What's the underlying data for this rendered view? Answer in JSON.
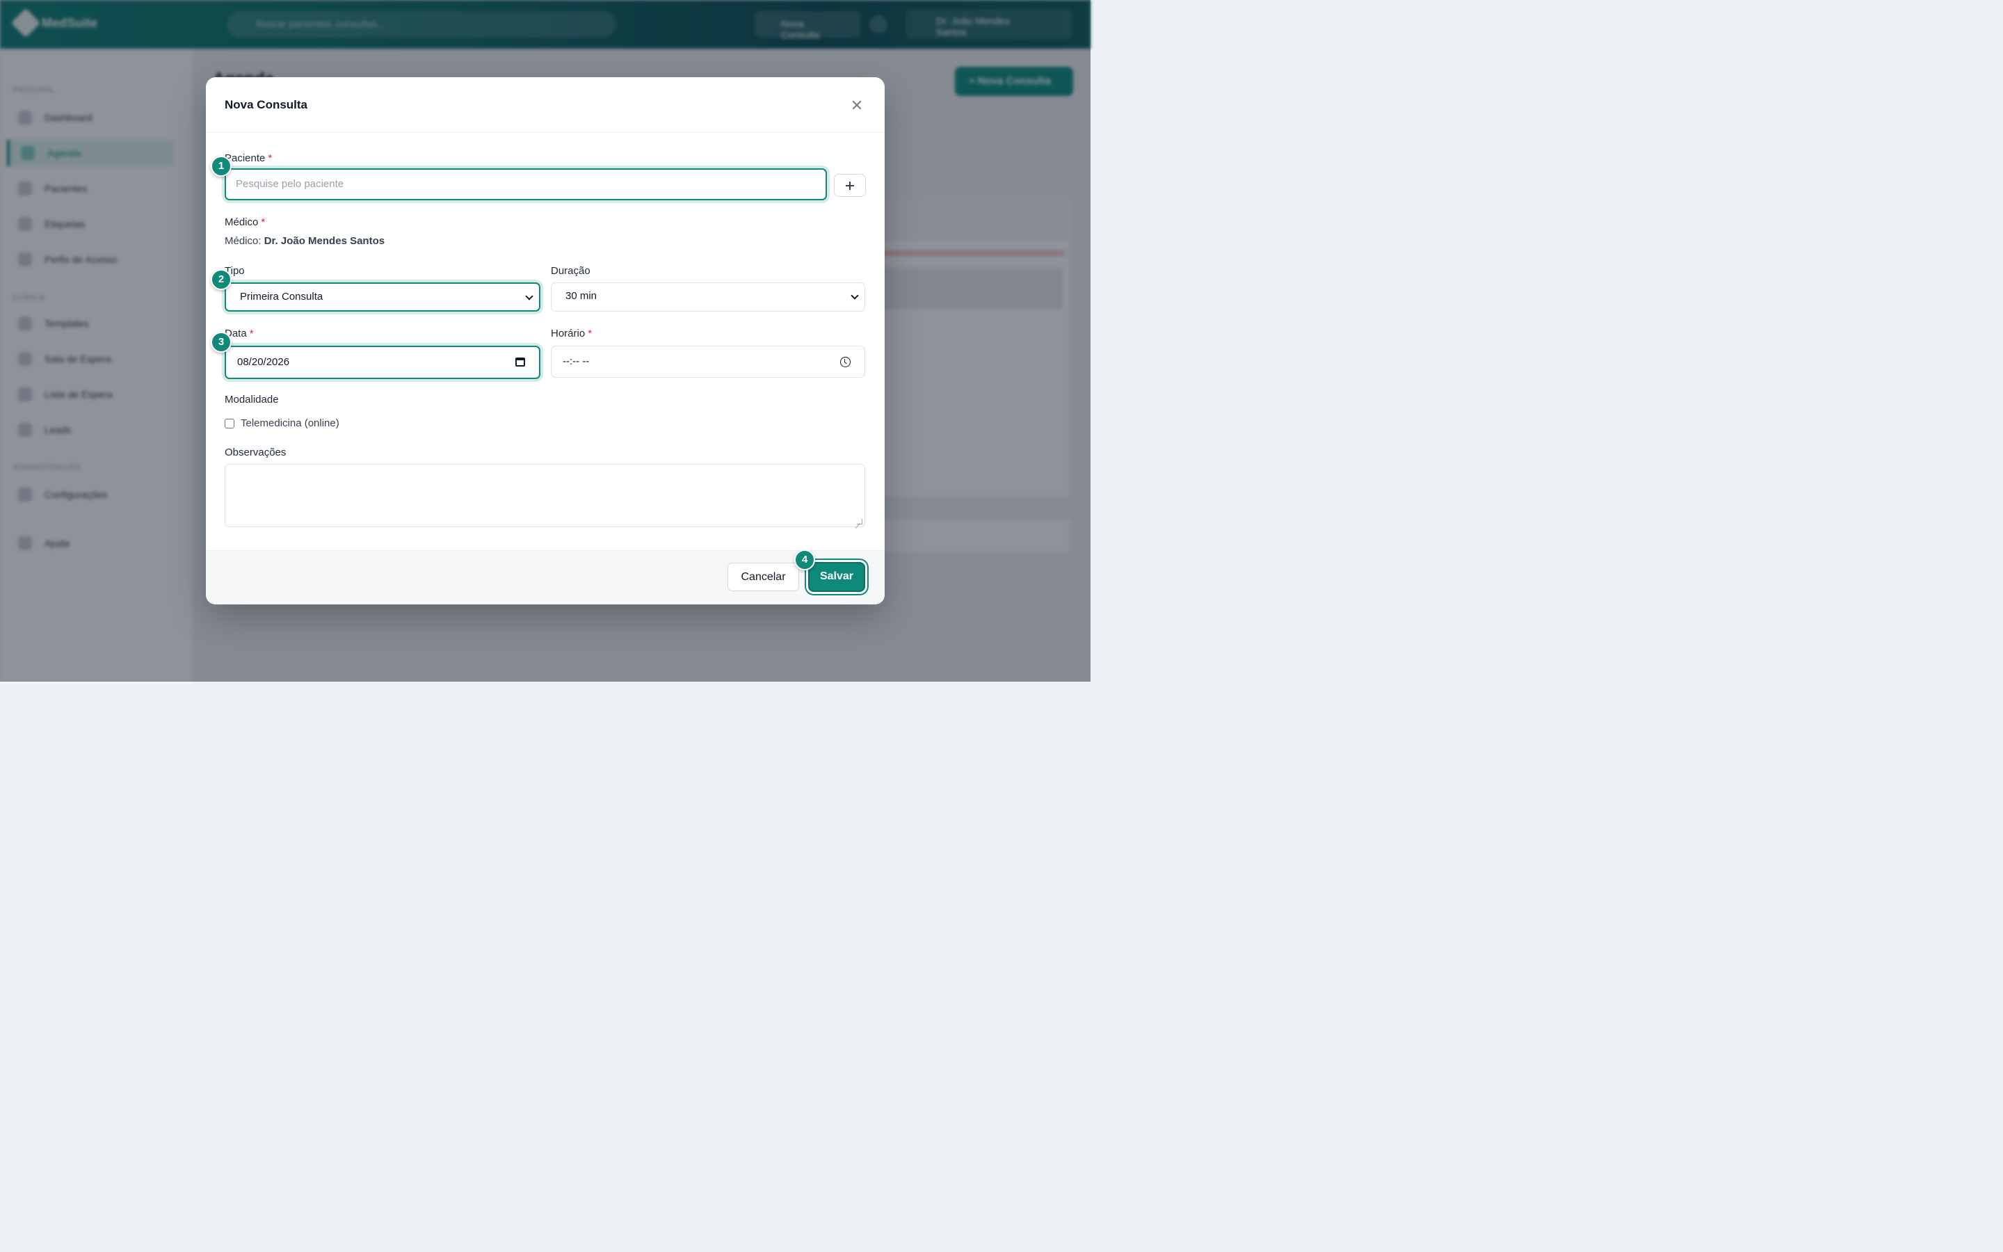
{
  "background": {
    "logo_text": "MedSuite",
    "search_placeholder": "Buscar pacientes, consultas...",
    "topbar_button": "Nova Consulta",
    "user_name": "Dr. João Mendes Santos",
    "page_title": "Agenda",
    "new_button": "+ Nova Consulta",
    "sidebar_sections": [
      "PRINCIPAL",
      "CLÍNICA",
      "ADMINISTRAÇÃO"
    ],
    "sidebar_items": [
      "Dashboard",
      "Agenda",
      "Pacientes",
      "Etiquetas",
      "Perfis de Acesso",
      "Templates",
      "Sala de Espera",
      "Lista de Espera",
      "Leads",
      "Configurações",
      "Ajuda"
    ]
  },
  "modal": {
    "title": "Nova Consulta",
    "patient": {
      "label": "Paciente",
      "required": "*",
      "placeholder": "Pesquise pelo paciente"
    },
    "doctor": {
      "label": "Médico",
      "required": "*",
      "prefix": "Médico:",
      "name": "Dr. João Mendes Santos"
    },
    "tipo": {
      "label": "Tipo",
      "value": "Primeira Consulta"
    },
    "duracao": {
      "label": "Duração",
      "value": "30 min"
    },
    "data": {
      "label": "Data",
      "required": "*",
      "value": "08/20/2026"
    },
    "horario": {
      "label": "Horário",
      "required": "*",
      "value": "--:-- --"
    },
    "modalidade": {
      "label": "Modalidade",
      "option": "Telemedicina (online)"
    },
    "observacoes": {
      "label": "Observações",
      "value": ""
    },
    "buttons": {
      "cancel": "Cancelar",
      "save": "Salvar"
    }
  },
  "steps": [
    "1",
    "2",
    "3",
    "4"
  ],
  "colors": {
    "accent": "#0f8a7a",
    "required": "#dc2626"
  }
}
